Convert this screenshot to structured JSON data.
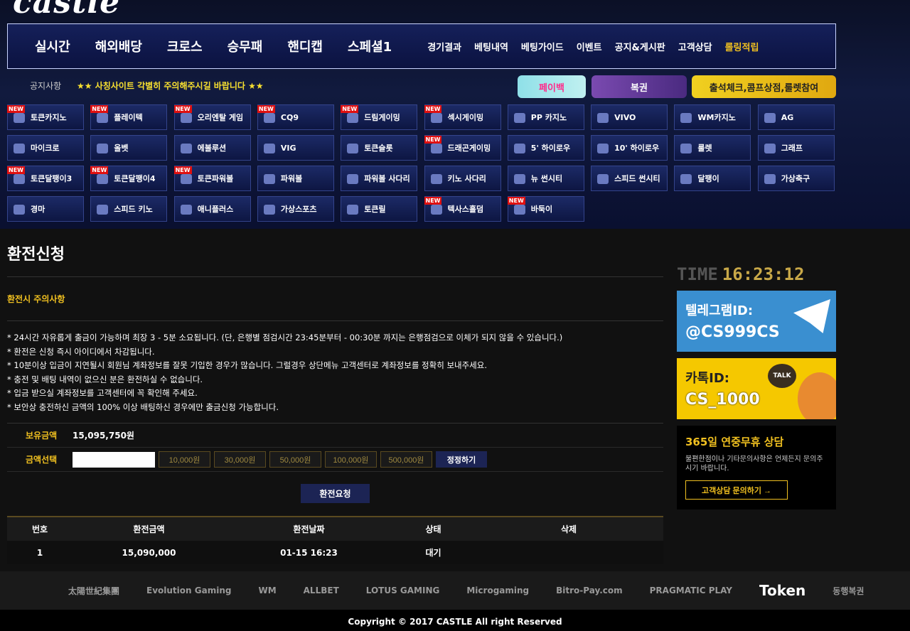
{
  "nav": {
    "main": [
      "실시간",
      "해외배당",
      "크로스",
      "승무패",
      "핸디캡",
      "스페셜1"
    ],
    "sub": [
      "경기결과",
      "베팅내역",
      "베팅가이드",
      "이벤트",
      "공지&게시판",
      "고객상담",
      "롤링적립"
    ]
  },
  "notice": {
    "label": "공지사항",
    "text": "★★ 사칭사이트 각별히 주의해주시길 바랍니다 ★★"
  },
  "promos": [
    "페이백",
    "복권",
    "출석체크,콤프상점,룰렛참여"
  ],
  "games": [
    {
      "label": "토큰카지노",
      "new": true
    },
    {
      "label": "플레이텍",
      "new": true
    },
    {
      "label": "오리엔탈 게임",
      "new": true
    },
    {
      "label": "CQ9",
      "new": true
    },
    {
      "label": "드림게이밍",
      "new": true
    },
    {
      "label": "섹시게이밍",
      "new": true
    },
    {
      "label": "PP 카지노",
      "new": false
    },
    {
      "label": "VIVO",
      "new": false
    },
    {
      "label": "WM카지노",
      "new": false
    },
    {
      "label": "AG",
      "new": false
    },
    {
      "label": "마이크로",
      "new": false
    },
    {
      "label": "올벳",
      "new": false
    },
    {
      "label": "에볼루션",
      "new": false
    },
    {
      "label": "VIG",
      "new": false
    },
    {
      "label": "토큰슬롯",
      "new": false
    },
    {
      "label": "드래곤게이밍",
      "new": true
    },
    {
      "label": "5' 하이로우",
      "new": false
    },
    {
      "label": "10' 하이로우",
      "new": false
    },
    {
      "label": "룰렛",
      "new": false
    },
    {
      "label": "그래프",
      "new": false
    },
    {
      "label": "토큰달팽이3",
      "new": true
    },
    {
      "label": "토큰달팽이4",
      "new": true
    },
    {
      "label": "토큰파워볼",
      "new": true
    },
    {
      "label": "파워볼",
      "new": false
    },
    {
      "label": "파워볼 사다리",
      "new": false
    },
    {
      "label": "키노 사다리",
      "new": false
    },
    {
      "label": "뉴 썬시티",
      "new": false
    },
    {
      "label": "스피드 썬시티",
      "new": false
    },
    {
      "label": "달팽이",
      "new": false
    },
    {
      "label": "가상축구",
      "new": false
    },
    {
      "label": "경마",
      "new": false
    },
    {
      "label": "스피드 키노",
      "new": false
    },
    {
      "label": "애니플러스",
      "new": false
    },
    {
      "label": "가상스포츠",
      "new": false
    },
    {
      "label": "토큰릴",
      "new": false
    },
    {
      "label": "텍사스홀덤",
      "new": true
    },
    {
      "label": "바둑이",
      "new": true
    }
  ],
  "page": {
    "title": "환전신청",
    "subtitle": "환전시 주의사항",
    "rules": [
      "* 24시간 자유롭게 출금이 가능하며 최장 3 - 5분 소요됩니다. (단, 은행별 점검시간 23:45분부터 - 00:30분 까지는 은행점검으로 이체가 되지 않을 수 있습니다.)",
      "* 환전은 신청 즉시 아이디에서 차감됩니다.",
      "* 10분이상 입금이 지연될시 회원님 계좌정보를 잘못 기입한 경우가 많습니다. 그럴경우 상단메뉴 고객센터로 계좌정보를 정확히 보내주세요.",
      "* 충전 및 배팅 내역이 없으신 분은 환전하실 수 없습니다.",
      "* 입금 받으실 계좌정보를 고객센터에 꼭 확인해 주세요.",
      "* 보안상 충전하신 금액의 100% 이상 배팅하신 경우에만 출금신청 가능합니다."
    ],
    "balance_label": "보유금액",
    "balance_value": "15,095,750원",
    "amount_label": "금액선택",
    "amount_value": "",
    "amount_options": [
      "10,000원",
      "30,000원",
      "50,000원",
      "100,000원",
      "500,000원"
    ],
    "fix_label": "정정하기",
    "request_label": "환전요청"
  },
  "table": {
    "headers": [
      "번호",
      "환전금액",
      "환전날짜",
      "상태",
      "삭제"
    ],
    "rows": [
      [
        "1",
        "15,090,000",
        "01-15 16:23",
        "대기",
        ""
      ]
    ]
  },
  "side": {
    "time_label": "TIME",
    "time_value": "16:23:12",
    "telegram_line1": "텔레그램ID:",
    "telegram_line2": "@CS999CS",
    "kakao_line1": "카톡ID:",
    "kakao_line2": "CS_1000",
    "kakao_badge": "TALK",
    "help_title": "365일 연중무휴 상담",
    "help_desc": "불편한점이나 기타문의사항은 언제든지 문의주시기 바랍니다.",
    "help_button": "고객상담 문의하기 →"
  },
  "partners": [
    "太陽世紀集團",
    "Evolution Gaming",
    "WM",
    "ALLBET",
    "LOTUS GAMING",
    "Microgaming",
    "Bitro-Pay.com",
    "PRAGMATIC PLAY",
    "Token",
    "동행복권"
  ],
  "copyright": "Copyright © 2017 CASTLE All right Reserved"
}
